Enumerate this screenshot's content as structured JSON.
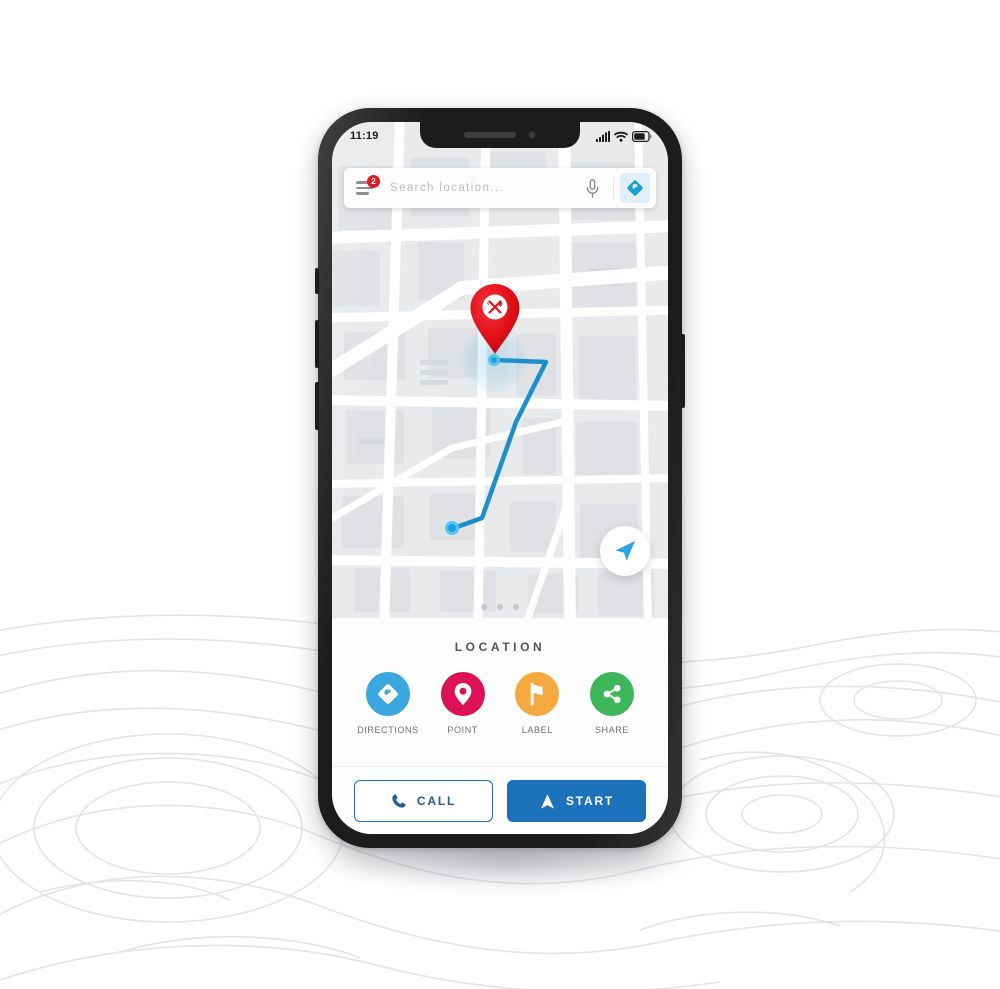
{
  "status_bar": {
    "time": "11:19",
    "icons": [
      "signal-icon",
      "wifi-icon",
      "battery-icon"
    ]
  },
  "search": {
    "placeholder": "Search location...",
    "menu_badge_count": "2",
    "menu_icon": "hamburger-menu-icon",
    "mic_icon": "microphone-icon",
    "directions_icon": "directions-diamond-icon"
  },
  "map": {
    "marker_icon": "restaurant-pin-icon",
    "destination_dot": "route-destination-dot",
    "origin_dot": "route-origin-dot",
    "nav_fab_icon": "navigation-arrow-icon",
    "page_dots": 3,
    "route_color": "#1a8fce",
    "pin_color": "#e8121c"
  },
  "sheet": {
    "title": "LOCATION",
    "actions": [
      {
        "label": "DIRECTIONS",
        "icon": "directions-diamond-icon",
        "color": "#3aa7de"
      },
      {
        "label": "POINT",
        "icon": "map-pin-icon",
        "color": "#dd1155"
      },
      {
        "label": "LABEL",
        "icon": "flag-icon",
        "color": "#f5a93f"
      },
      {
        "label": "SHARE",
        "icon": "share-nodes-icon",
        "color": "#3eb65a"
      }
    ],
    "call_button": {
      "label": "CALL",
      "icon": "phone-icon"
    },
    "start_button": {
      "label": "START",
      "icon": "navigation-arrow-icon"
    }
  },
  "device": {
    "side_buttons": [
      "silent-switch",
      "volume-up-button",
      "volume-down-button",
      "power-button"
    ],
    "notch_items": [
      "earpiece-speaker",
      "front-camera"
    ]
  },
  "colors": {
    "accent_blue": "#1c72ba",
    "map_bg": "#e9eaec",
    "road": "#ffffff",
    "badge_red": "#e01b22"
  }
}
